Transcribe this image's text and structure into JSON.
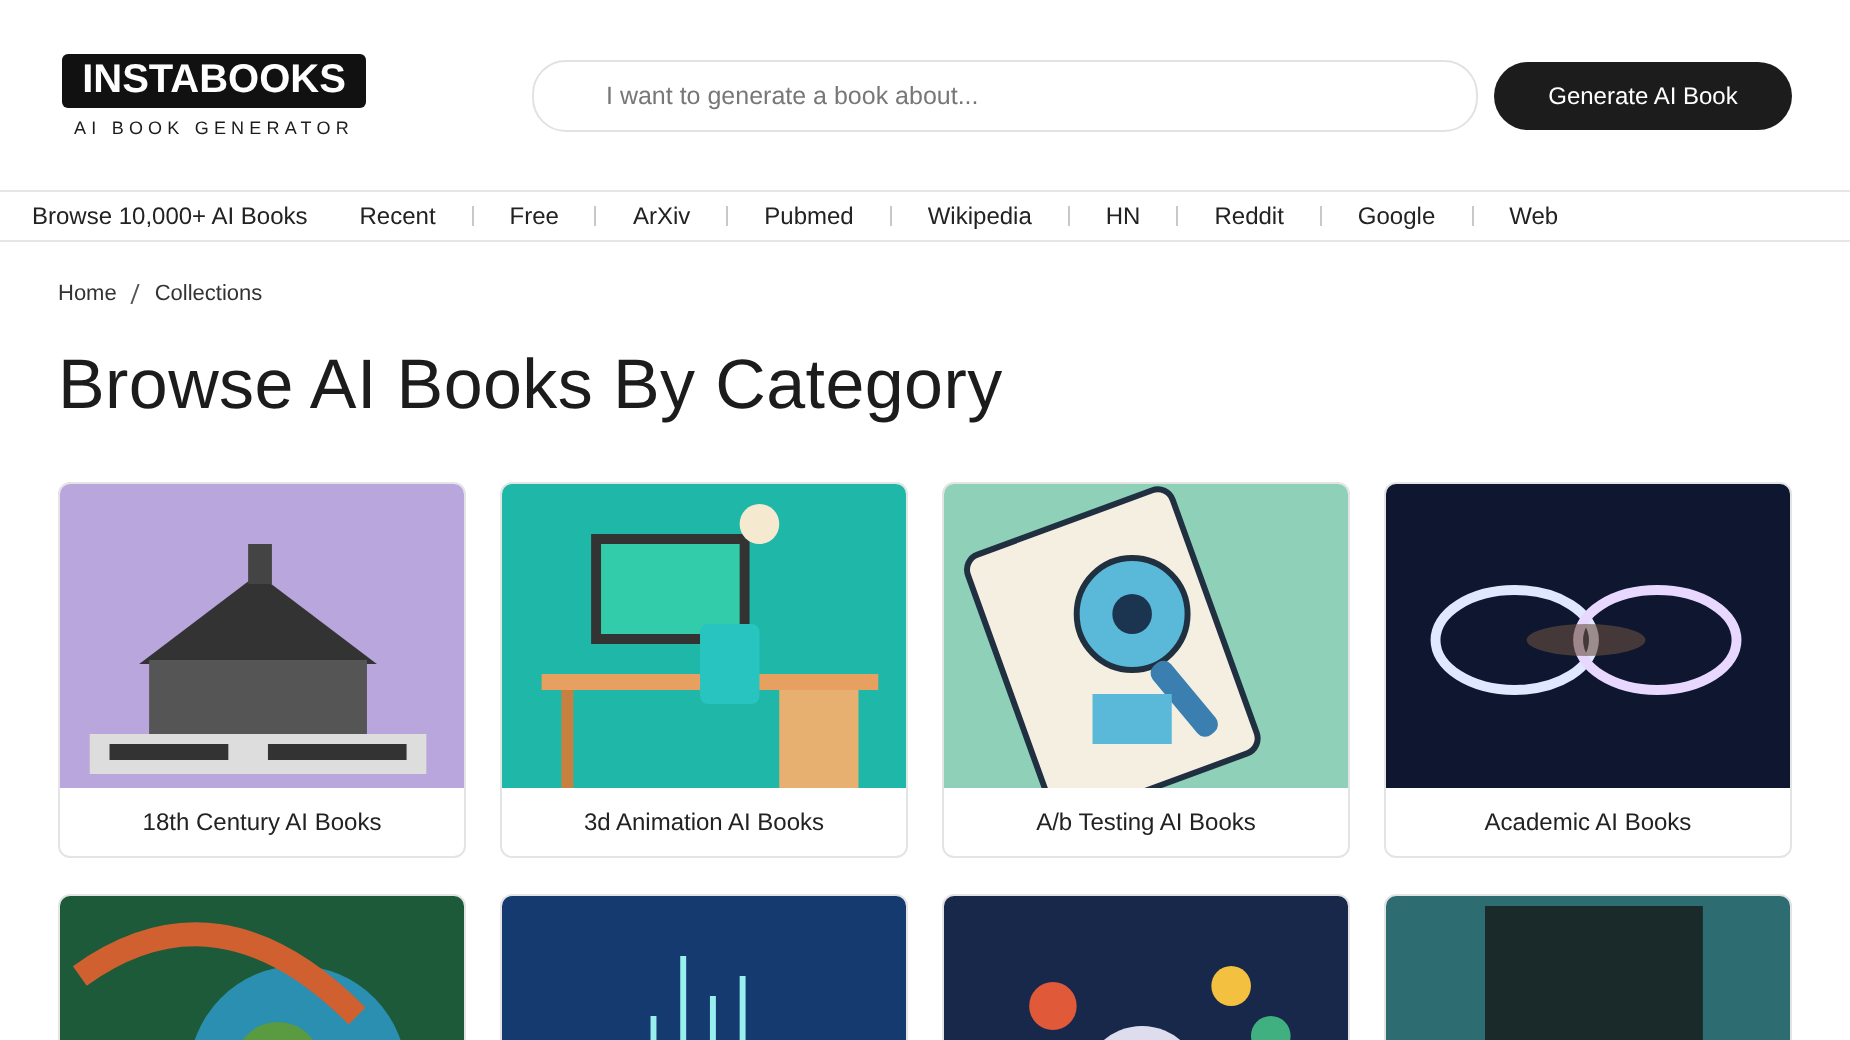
{
  "logo": {
    "title": "INSTABOOKS",
    "subtitle": "AI BOOK GENERATOR"
  },
  "search": {
    "placeholder": "I want to generate a book about..."
  },
  "generate_button": "Generate AI Book",
  "nav": {
    "browse": "Browse 10,000+ AI Books",
    "links": [
      "Recent",
      "Free",
      "ArXiv",
      "Pubmed",
      "Wikipedia",
      "HN",
      "Reddit",
      "Google",
      "Web"
    ]
  },
  "breadcrumb": [
    "Home",
    "Collections"
  ],
  "heading": "Browse AI Books By Category",
  "cards": [
    {
      "kind": "picture",
      "title": "18th Century AI Books"
    },
    {
      "kind": "picture",
      "title": "3d Animation AI Books"
    },
    {
      "kind": "picture",
      "title": "A/b Testing AI Books"
    },
    {
      "kind": "picture",
      "title": "Academic AI Books"
    },
    {
      "kind": "picture"
    },
    {
      "kind": "picture"
    },
    {
      "kind": "picture"
    },
    {
      "kind": "picture"
    }
  ]
}
